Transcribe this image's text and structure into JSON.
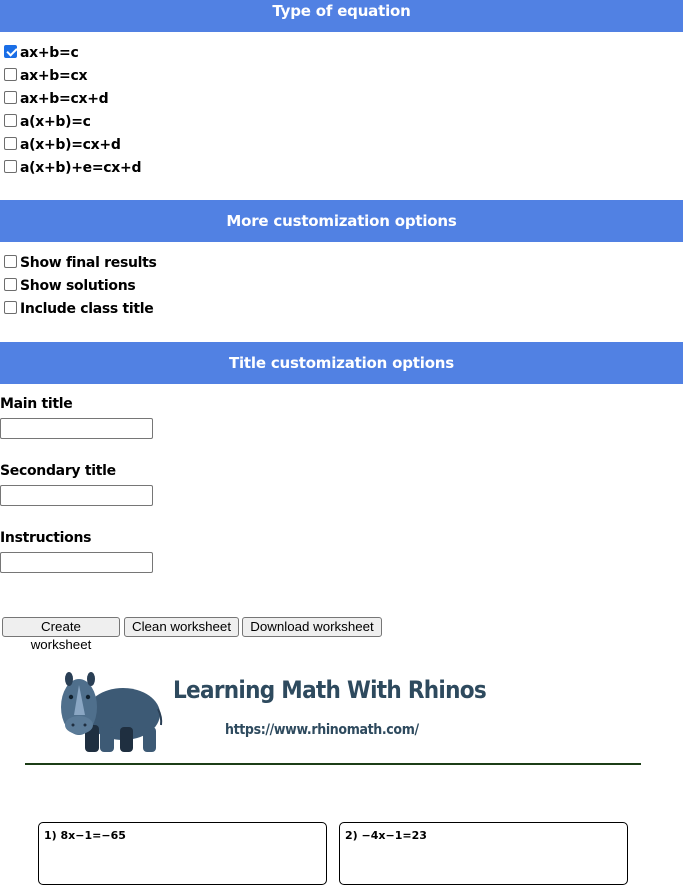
{
  "sections": {
    "type_header": "Type of equation",
    "more_header": "More customization options",
    "title_header": "Title customization options"
  },
  "equation_types": [
    {
      "label": "ax+b=c",
      "checked": true
    },
    {
      "label": "ax+b=cx",
      "checked": false
    },
    {
      "label": "ax+b=cx+d",
      "checked": false
    },
    {
      "label": "a(x+b)=c",
      "checked": false
    },
    {
      "label": "a(x+b)=cx+d",
      "checked": false
    },
    {
      "label": "a(x+b)+e=cx+d",
      "checked": false
    }
  ],
  "more_options": [
    {
      "label": "Show final results",
      "checked": false
    },
    {
      "label": "Show solutions",
      "checked": false
    },
    {
      "label": "Include class title",
      "checked": false
    }
  ],
  "title_fields": [
    {
      "label": "Main title",
      "value": ""
    },
    {
      "label": "Secondary title",
      "value": ""
    },
    {
      "label": "Instructions",
      "value": ""
    }
  ],
  "buttons": {
    "create": "Create worksheet",
    "clean": "Clean worksheet",
    "download": "Download worksheet"
  },
  "logo": {
    "title": "Learning Math With Rhinos",
    "url": "https://www.rhinomath.com/"
  },
  "problems": [
    {
      "text": "1) 8x−1=−65"
    },
    {
      "text": "2) −4x−1=23"
    }
  ],
  "colors": {
    "header_bg": "#5181e3",
    "checkbox_checked": "#1a6ee6",
    "logo_text": "#2e4a5e",
    "divider": "#1c3d16"
  }
}
